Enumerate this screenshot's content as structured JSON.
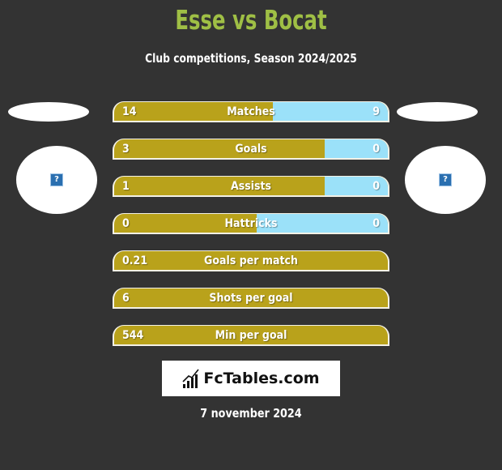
{
  "header": {
    "title": "Esse vs Bocat",
    "subtitle": "Club competitions, Season 2024/2025"
  },
  "teams": {
    "left": {
      "logo_icon": "broken-image-icon"
    },
    "right": {
      "logo_icon": "broken-image-icon"
    }
  },
  "colors": {
    "left_bar": "#b9a21b",
    "right_bar": "#9be1f9",
    "title": "#9fbf45",
    "background": "#333333"
  },
  "stats": [
    {
      "label": "Matches",
      "left": "14",
      "right": "9",
      "left_share": 0.58
    },
    {
      "label": "Goals",
      "left": "3",
      "right": "0",
      "left_share": 0.77
    },
    {
      "label": "Assists",
      "left": "1",
      "right": "0",
      "left_share": 0.77
    },
    {
      "label": "Hattricks",
      "left": "0",
      "right": "0",
      "left_share": 0.52
    },
    {
      "label": "Goals per match",
      "left": "0.21",
      "right": "",
      "left_share": 1
    },
    {
      "label": "Shots per goal",
      "left": "6",
      "right": "",
      "left_share": 1
    },
    {
      "label": "Min per goal",
      "left": "544",
      "right": "",
      "left_share": 1
    }
  ],
  "logo": {
    "text": "FcTables.com",
    "icon": "bar-chart-trend-icon"
  },
  "footer": {
    "date": "7 november 2024"
  }
}
